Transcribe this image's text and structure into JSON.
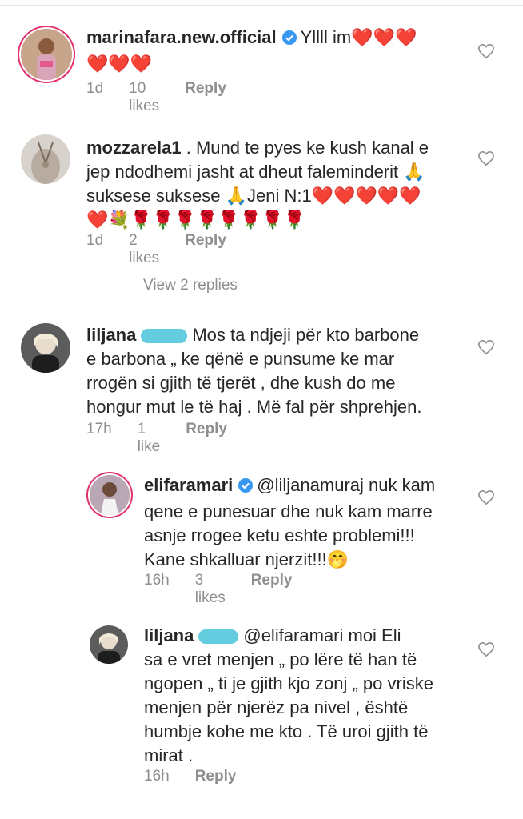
{
  "colors": {
    "text": "#262626",
    "meta": "#8e8e8e",
    "verified": "#3897f0",
    "ring": "#e1306c"
  },
  "comments": [
    {
      "username": "marinafara.new.official",
      "verified": true,
      "text_line1": "Yllll im❤️❤️❤️",
      "text_line2": "❤️❤️❤️",
      "time": "1d",
      "likes": "10 likes",
      "reply": "Reply"
    },
    {
      "username": "mozzarela1",
      "text_line1": ". Mund te pyes ke kush kanal e",
      "text_line2": "jep ndodhemi jasht at dheut faleminderit 🙏",
      "text_line3": "suksese suksese 🙏Jeni N:1❤️❤️❤️❤️❤️",
      "text_line4": "❤️💐🌹🌹🌹🌹🌹🌹🌹🌹",
      "time": "1d",
      "likes": "2 likes",
      "reply": "Reply"
    },
    {
      "username": "liljana",
      "text_line1": "Mos ta ndjeji për kto  barbone",
      "text_line2": "e barbona „ ke qënë e punsume ke mar",
      "text_line3": "rrogën si gjith të tjerët , dhe kush do me",
      "text_line4": "hongur mut le të haj . Më fal për shprehjen.",
      "time": "17h",
      "likes": "1 like",
      "reply": "Reply"
    },
    {
      "username": "elifaramari",
      "verified": true,
      "text_line1": "@liljanamuraj nuk kam",
      "text_line2": "qene e punesuar dhe nuk kam marre",
      "text_line3": "asnje rrogee ketu eshte problemi!!!",
      "text_line4": "Kane shkalluar njerzit!!!🤭",
      "time": "16h",
      "likes": "3 likes",
      "reply": "Reply"
    },
    {
      "username": "liljana",
      "text_line1": "@elifaramari moi Eli",
      "text_line2": "sa e vret menjen „ po lëre të han të",
      "text_line3": "ngopen „ ti je gjith kjo zonj „ po vriske",
      "text_line4": "menjen për njerëz pa nivel , është",
      "text_line5": "humbje kohe me kto . Të uroi gjith të",
      "text_line6": "mirat .",
      "time": "16h",
      "reply": "Reply"
    }
  ],
  "view_replies": "View 2 replies",
  "icons": {
    "like": "heart-outline-icon",
    "verified": "verified-badge-icon"
  }
}
